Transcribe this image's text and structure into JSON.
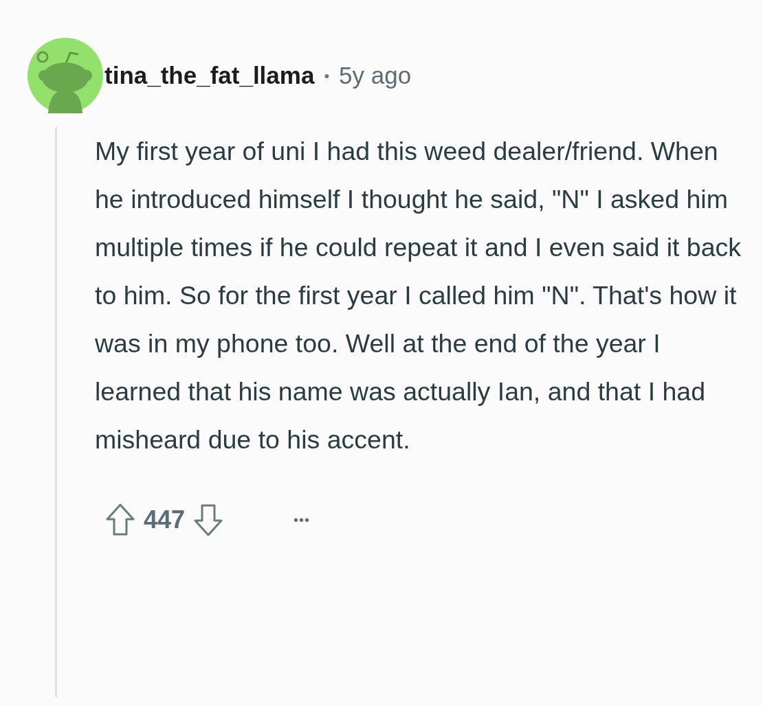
{
  "comment": {
    "author": "tina_the_fat_llama",
    "separator": "•",
    "age": "5y ago",
    "body": "My first year of uni I had this weed dealer/friend. When he introduced himself I thought he said, \"N\" I asked him multiple times if he could repeat it and I even said it back to him. So for the first year I called him \"N\". That's how it was in my phone too. Well at the end of the year I learned that his name was actually Ian, and that I had misheard due to his accent.",
    "score": "447",
    "more": "•••"
  }
}
